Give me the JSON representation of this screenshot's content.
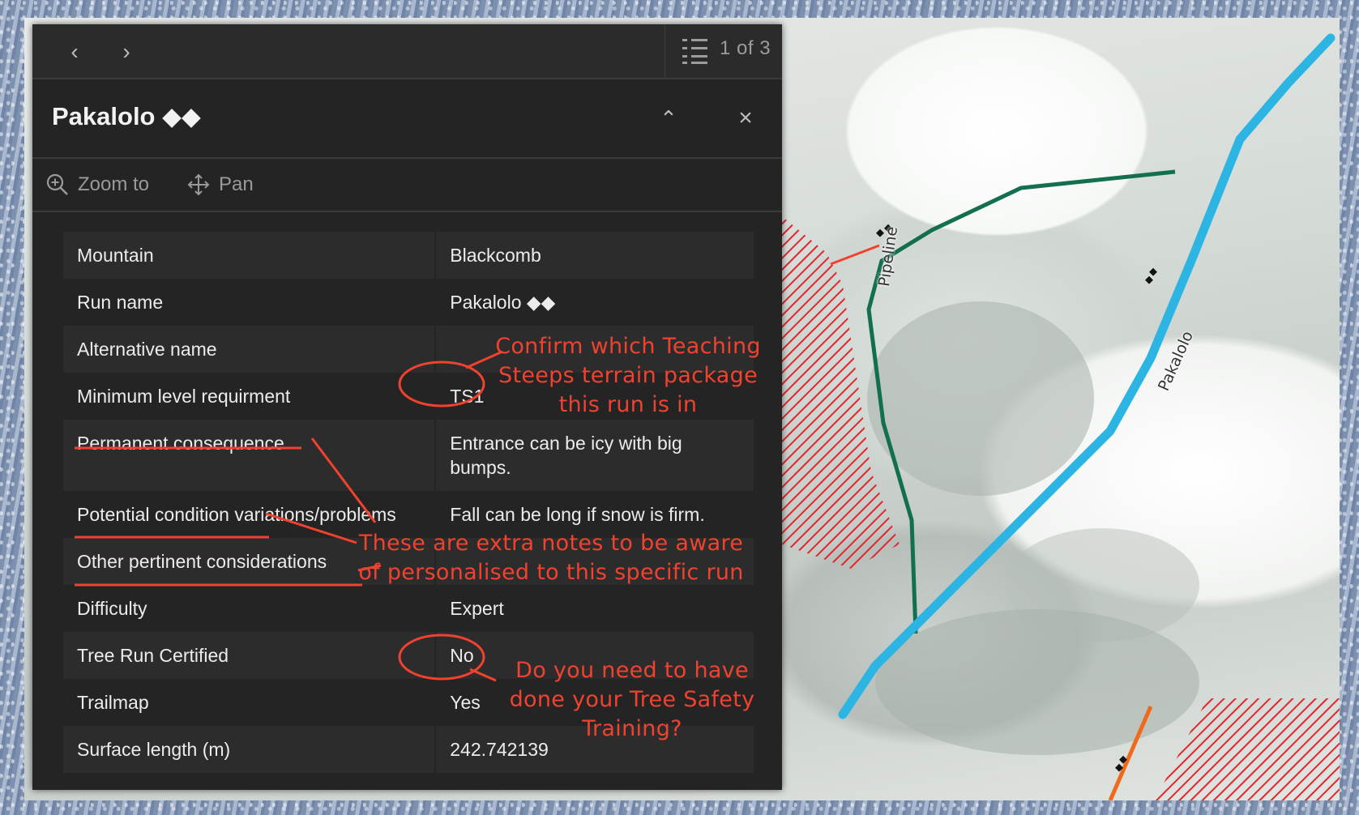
{
  "popup": {
    "page_count": "1 of 3",
    "title": "Pakalolo ◆◆",
    "actions": {
      "zoom_label": "Zoom to",
      "pan_label": "Pan"
    },
    "attributes": [
      {
        "key": "Mountain",
        "value": "Blackcomb"
      },
      {
        "key": "Run name",
        "value": "Pakalolo ◆◆"
      },
      {
        "key": "Alternative name",
        "value": ""
      },
      {
        "key": "Minimum level requirment",
        "value": "TS1"
      },
      {
        "key": "Permanent consequence",
        "value": "Entrance can be icy with big bumps."
      },
      {
        "key": "Potential condition variations/problems",
        "value": "Fall can be long if snow is firm."
      },
      {
        "key": "Other pertinent considerations",
        "value": ""
      },
      {
        "key": "Difficulty",
        "value": "Expert"
      },
      {
        "key": "Tree Run Certified",
        "value": "No"
      },
      {
        "key": "Trailmap",
        "value": "Yes"
      },
      {
        "key": "Surface length (m)",
        "value": "242.742139"
      }
    ]
  },
  "annotations": {
    "teaching": "Confirm which Teaching Steeps terrain package this run is in",
    "extra_notes": "These are extra notes to be aware of personalised to this specific run",
    "tree_training": "Do you need to have done your Tree Safety Training?"
  },
  "map": {
    "labels": {
      "pipeline": "Pipeline",
      "pakalolo": "Pakalolo"
    }
  },
  "colors": {
    "annotation": "#f0422f",
    "panel_bg": "#242424",
    "run_blue": "#2cb5e3",
    "run_green": "#13704f",
    "run_orange": "#f06a1d",
    "hazard_red": "#e3252d"
  }
}
